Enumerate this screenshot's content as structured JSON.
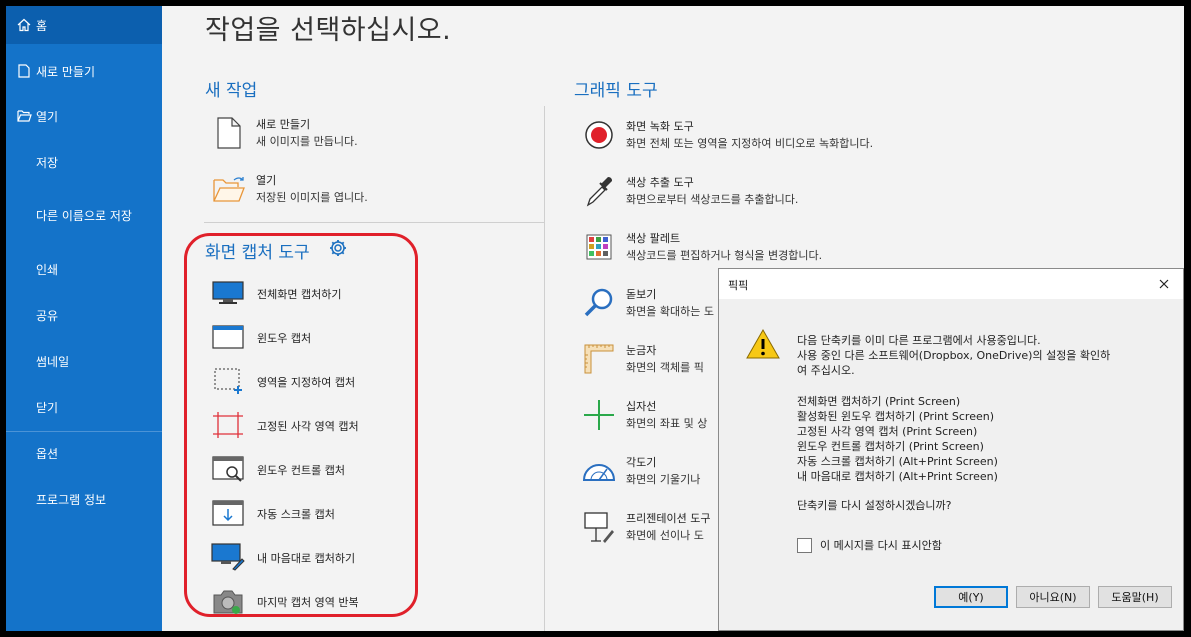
{
  "sidebar": {
    "items": [
      {
        "label": "홈",
        "icon": "home-icon"
      },
      {
        "label": "새로 만들기",
        "icon": "new-file-icon"
      },
      {
        "label": "열기",
        "icon": "open-folder-icon"
      },
      {
        "label": "저장"
      },
      {
        "label": "다른 이름으로 저장"
      },
      {
        "label": "인쇄"
      },
      {
        "label": "공유"
      },
      {
        "label": "썸네일"
      },
      {
        "label": "닫기"
      },
      {
        "label": "옵션"
      },
      {
        "label": "프로그램 정보"
      }
    ]
  },
  "main": {
    "title": "작업을 선택하십시오.",
    "new_work": {
      "title": "새 작업",
      "items": [
        {
          "title": "새로 만들기",
          "desc": "새 이미지를 만듭니다.",
          "icon": "new-document-icon"
        },
        {
          "title": "열기",
          "desc": "저장된 이미지를 엽니다.",
          "icon": "open-folder-icon"
        }
      ]
    },
    "capture": {
      "title": "화면 캡처 도구",
      "items": [
        {
          "label": "전체화면 캡처하기",
          "icon": "fullscreen-capture-icon"
        },
        {
          "label": "윈도우 캡처",
          "icon": "window-capture-icon"
        },
        {
          "label": "영역을 지정하여 캡처",
          "icon": "region-capture-icon"
        },
        {
          "label": "고정된 사각 영역 캡처",
          "icon": "fixed-rect-capture-icon"
        },
        {
          "label": "윈도우 컨트롤 캡처",
          "icon": "control-capture-icon"
        },
        {
          "label": "자동 스크롤 캡처",
          "icon": "scroll-capture-icon"
        },
        {
          "label": "내 마음대로 캡처하기",
          "icon": "freeform-capture-icon"
        },
        {
          "label": "마지막 캡처 영역 반복",
          "icon": "repeat-capture-icon"
        }
      ]
    },
    "graphic_tools": {
      "title": "그래픽 도구",
      "items": [
        {
          "title": "화면 녹화 도구",
          "desc": "화면 전체 또는 영역을 지정하여 비디오로 녹화합니다.",
          "icon": "record-icon"
        },
        {
          "title": "색상 추출 도구",
          "desc": "화면으로부터 색상코드를 추출합니다.",
          "icon": "eyedropper-icon"
        },
        {
          "title": "색상 팔레트",
          "desc": "색상코드를 편집하거나 형식을 변경합니다.",
          "icon": "palette-icon"
        },
        {
          "title": "돋보기",
          "desc": "화면을 확대하는 도",
          "icon": "magnifier-icon"
        },
        {
          "title": "눈금자",
          "desc": "화면의 객체를 픽",
          "icon": "ruler-icon"
        },
        {
          "title": "십자선",
          "desc": "화면의 좌표 및 상",
          "icon": "crosshair-icon"
        },
        {
          "title": "각도기",
          "desc": "화면의 기울기나",
          "icon": "protractor-icon"
        },
        {
          "title": "프리젠테이션 도구",
          "desc": "화면에 선이나 도",
          "icon": "presentation-icon"
        }
      ]
    }
  },
  "dialog": {
    "title": "픽픽",
    "lines": [
      "다음 단축키를 이미 다른 프로그램에서 사용중입니다.",
      "사용 중인 다른 소프트웨어(Dropbox, OneDrive)의 설정을 확인하",
      "여 주십시오.",
      "전체화면 캡처하기 (Print Screen)",
      "활성화된 윈도우 캡처하기 (Print Screen)",
      "고정된 사각 영역 캡처 (Print Screen)",
      "윈도우 컨트롤 캡처하기 (Print Screen)",
      "자동 스크롤 캡처하기 (Alt+Print Screen)",
      "내 마음대로 캡처하기 (Alt+Print Screen)",
      "단축키를 다시 설정하시겠습니까?"
    ],
    "checkbox_label": "이 메시지를 다시 표시안함",
    "buttons": {
      "yes": "예(Y)",
      "no": "아니요(N)",
      "help": "도움말(H)"
    }
  },
  "colors": {
    "sidebar": "#1473c9",
    "accent": "#1a6fc0",
    "highlight": "#e0202a"
  }
}
